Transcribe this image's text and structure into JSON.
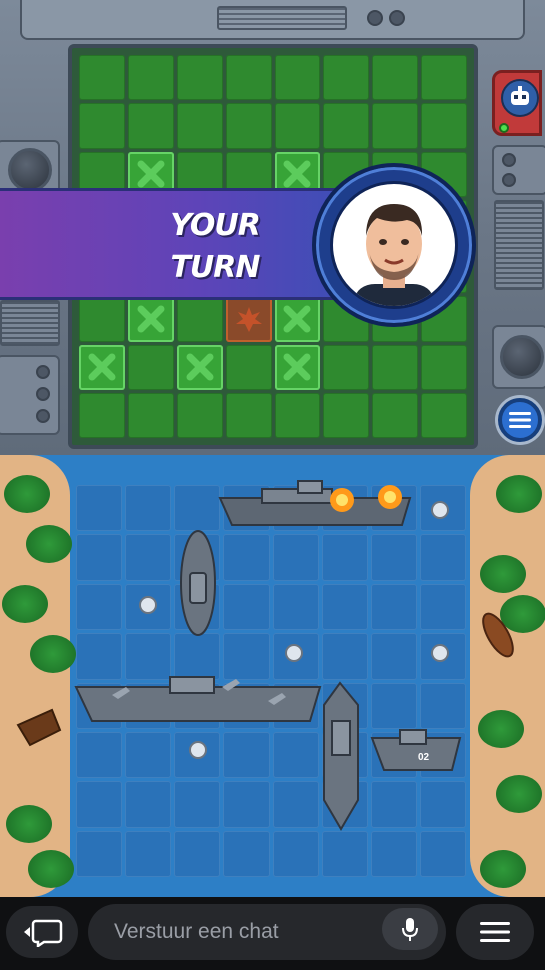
{
  "banner": {
    "line1": "YOUR",
    "line2": "TURN"
  },
  "radar": {
    "rows": 8,
    "cols": 8,
    "cells": [
      [
        "empty",
        "empty",
        "empty",
        "empty",
        "empty",
        "empty",
        "empty",
        "empty"
      ],
      [
        "empty",
        "empty",
        "empty",
        "empty",
        "empty",
        "empty",
        "empty",
        "empty"
      ],
      [
        "empty",
        "miss",
        "empty",
        "empty",
        "miss",
        "empty",
        "empty",
        "empty"
      ],
      [
        "empty",
        "empty",
        "empty",
        "empty",
        "empty",
        "empty",
        "empty",
        "empty"
      ],
      [
        "empty",
        "empty",
        "empty",
        "empty",
        "empty",
        "empty",
        "empty",
        "empty"
      ],
      [
        "empty",
        "miss",
        "empty",
        "hit",
        "miss",
        "empty",
        "empty",
        "empty"
      ],
      [
        "miss",
        "empty",
        "miss",
        "empty",
        "miss",
        "empty",
        "empty",
        "empty"
      ],
      [
        "empty",
        "empty",
        "empty",
        "empty",
        "empty",
        "empty",
        "empty",
        "empty"
      ]
    ]
  },
  "fleet": {
    "rows": 8,
    "cols": 8
  },
  "ship_markings": {
    "patrol_boat_number": "02"
  },
  "chat": {
    "placeholder": "Verstuur een chat"
  },
  "icons": {
    "miss": "x-mark-icon",
    "hit": "fire-icon",
    "menu": "menu-icon",
    "mic": "microphone-icon",
    "chat_back": "chat-back-icon"
  },
  "colors": {
    "radar_cell": "#2f8a2f",
    "miss_mark": "#5ccc5c",
    "hit_cell": "#8a4a2a",
    "banner_start": "#7a3fae",
    "banner_end": "#3a4fb6",
    "sea": "#2d7fc6"
  }
}
